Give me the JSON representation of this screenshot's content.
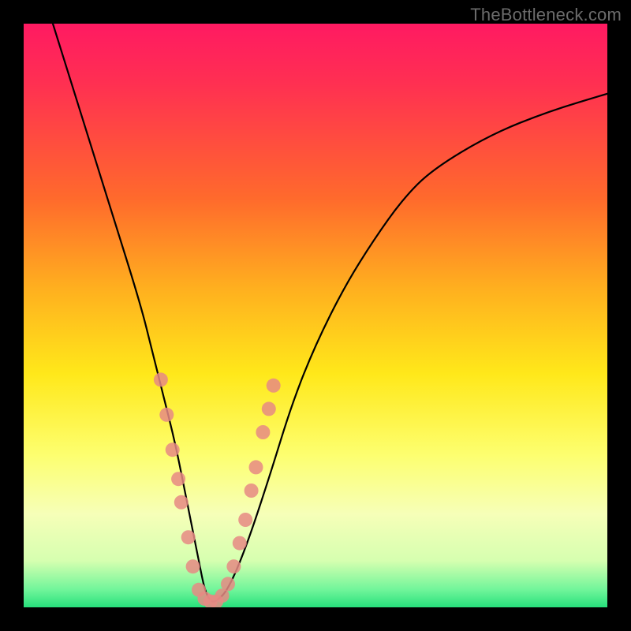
{
  "watermark_text": "TheBottleneck.com",
  "chart_data": {
    "type": "line",
    "title": "",
    "xlabel": "",
    "ylabel": "",
    "xlim": [
      0,
      100
    ],
    "ylim": [
      0,
      100
    ],
    "grid": false,
    "legend": false,
    "background_gradient": {
      "direction": "vertical",
      "stops": [
        {
          "pos": 0,
          "meaning": "high bottleneck",
          "color": "#ff1a62"
        },
        {
          "pos": 50,
          "meaning": "medium",
          "color": "#ffe81a"
        },
        {
          "pos": 100,
          "meaning": "no bottleneck",
          "color": "#27e07c"
        }
      ]
    },
    "series": [
      {
        "name": "bottleneck-curve",
        "x": [
          5,
          10,
          15,
          20,
          22,
          24,
          26,
          28,
          30,
          31,
          32,
          33,
          35,
          38,
          42,
          46,
          50,
          55,
          60,
          65,
          70,
          80,
          90,
          100
        ],
        "values": [
          100,
          84,
          68,
          52,
          44,
          36,
          28,
          18,
          8,
          3,
          1,
          1,
          3,
          10,
          22,
          35,
          45,
          55,
          63,
          70,
          75,
          81,
          85,
          88
        ]
      }
    ],
    "markers": [
      {
        "x": 23.5,
        "y": 39
      },
      {
        "x": 24.5,
        "y": 33
      },
      {
        "x": 25.5,
        "y": 27
      },
      {
        "x": 26.5,
        "y": 22
      },
      {
        "x": 27.0,
        "y": 18
      },
      {
        "x": 28.2,
        "y": 12
      },
      {
        "x": 29.0,
        "y": 7
      },
      {
        "x": 30.0,
        "y": 3
      },
      {
        "x": 31.0,
        "y": 1.5
      },
      {
        "x": 32.0,
        "y": 1
      },
      {
        "x": 33.0,
        "y": 1
      },
      {
        "x": 34.0,
        "y": 2
      },
      {
        "x": 35.0,
        "y": 4
      },
      {
        "x": 36.0,
        "y": 7
      },
      {
        "x": 37.0,
        "y": 11
      },
      {
        "x": 38.0,
        "y": 15
      },
      {
        "x": 39.0,
        "y": 20
      },
      {
        "x": 39.8,
        "y": 24
      },
      {
        "x": 41.0,
        "y": 30
      },
      {
        "x": 42.0,
        "y": 34
      },
      {
        "x": 42.8,
        "y": 38
      }
    ],
    "marker_style": {
      "color": "#e68a84",
      "radius_px": 9
    }
  }
}
